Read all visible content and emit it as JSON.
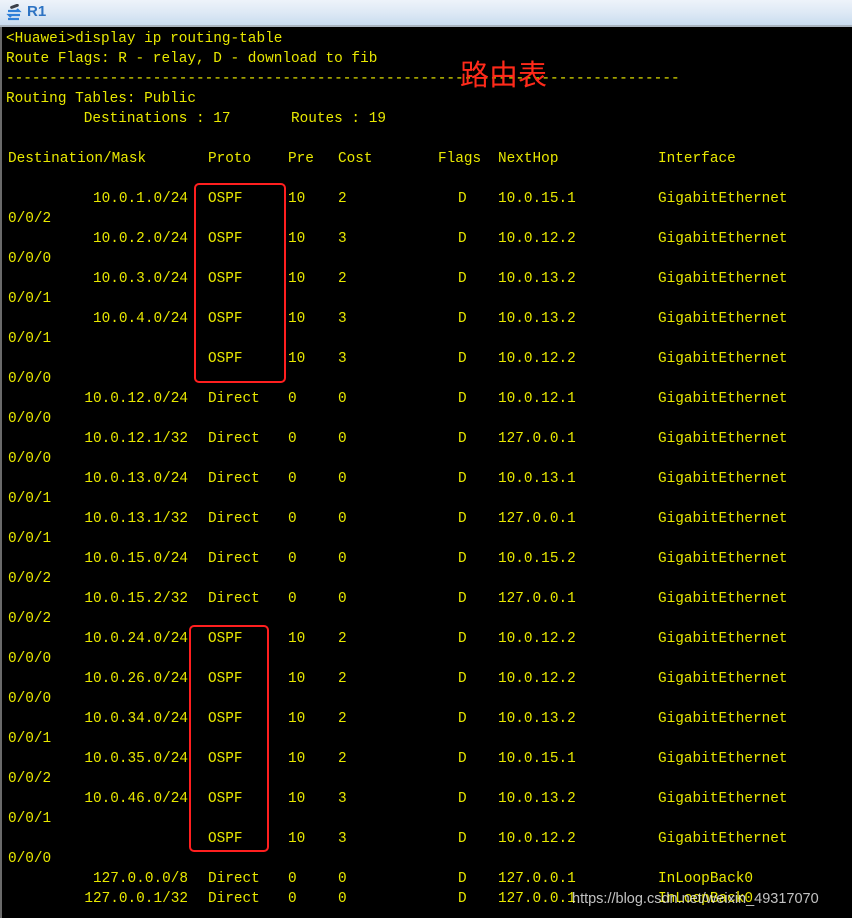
{
  "window": {
    "title": "R1",
    "icon": "router-icon"
  },
  "terminal": {
    "prompt_line": "<Huawei>display ip routing-table",
    "flags_line": "Route Flags: R - relay, D - download to fib",
    "separator": "------------------------------------------------------------------------------",
    "tables_line": "Routing Tables: Public",
    "summary_line": "         Destinations : 17       Routes : 19",
    "columns": [
      "Destination/Mask",
      "Proto",
      "Pre",
      "Cost",
      "Flags",
      "NextHop",
      "Interface"
    ],
    "routes": [
      {
        "dest": "10.0.1.0/24",
        "proto": "OSPF",
        "pre": "10",
        "cost": "2",
        "flags": "D",
        "nexthop": "10.0.15.1",
        "iface": "GigabitEthernet",
        "iface_cont": "0/0/2"
      },
      {
        "dest": "10.0.2.0/24",
        "proto": "OSPF",
        "pre": "10",
        "cost": "3",
        "flags": "D",
        "nexthop": "10.0.12.2",
        "iface": "GigabitEthernet",
        "iface_cont": "0/0/0"
      },
      {
        "dest": "10.0.3.0/24",
        "proto": "OSPF",
        "pre": "10",
        "cost": "2",
        "flags": "D",
        "nexthop": "10.0.13.2",
        "iface": "GigabitEthernet",
        "iface_cont": "0/0/1"
      },
      {
        "dest": "10.0.4.0/24",
        "proto": "OSPF",
        "pre": "10",
        "cost": "3",
        "flags": "D",
        "nexthop": "10.0.13.2",
        "iface": "GigabitEthernet",
        "iface_cont": "0/0/1"
      },
      {
        "dest": "",
        "proto": "OSPF",
        "pre": "10",
        "cost": "3",
        "flags": "D",
        "nexthop": "10.0.12.2",
        "iface": "GigabitEthernet",
        "iface_cont": "0/0/0"
      },
      {
        "dest": "10.0.12.0/24",
        "proto": "Direct",
        "pre": "0",
        "cost": "0",
        "flags": "D",
        "nexthop": "10.0.12.1",
        "iface": "GigabitEthernet",
        "iface_cont": "0/0/0"
      },
      {
        "dest": "10.0.12.1/32",
        "proto": "Direct",
        "pre": "0",
        "cost": "0",
        "flags": "D",
        "nexthop": "127.0.0.1",
        "iface": "GigabitEthernet",
        "iface_cont": "0/0/0"
      },
      {
        "dest": "10.0.13.0/24",
        "proto": "Direct",
        "pre": "0",
        "cost": "0",
        "flags": "D",
        "nexthop": "10.0.13.1",
        "iface": "GigabitEthernet",
        "iface_cont": "0/0/1"
      },
      {
        "dest": "10.0.13.1/32",
        "proto": "Direct",
        "pre": "0",
        "cost": "0",
        "flags": "D",
        "nexthop": "127.0.0.1",
        "iface": "GigabitEthernet",
        "iface_cont": "0/0/1"
      },
      {
        "dest": "10.0.15.0/24",
        "proto": "Direct",
        "pre": "0",
        "cost": "0",
        "flags": "D",
        "nexthop": "10.0.15.2",
        "iface": "GigabitEthernet",
        "iface_cont": "0/0/2"
      },
      {
        "dest": "10.0.15.2/32",
        "proto": "Direct",
        "pre": "0",
        "cost": "0",
        "flags": "D",
        "nexthop": "127.0.0.1",
        "iface": "GigabitEthernet",
        "iface_cont": "0/0/2"
      },
      {
        "dest": "10.0.24.0/24",
        "proto": "OSPF",
        "pre": "10",
        "cost": "2",
        "flags": "D",
        "nexthop": "10.0.12.2",
        "iface": "GigabitEthernet",
        "iface_cont": "0/0/0"
      },
      {
        "dest": "10.0.26.0/24",
        "proto": "OSPF",
        "pre": "10",
        "cost": "2",
        "flags": "D",
        "nexthop": "10.0.12.2",
        "iface": "GigabitEthernet",
        "iface_cont": "0/0/0"
      },
      {
        "dest": "10.0.34.0/24",
        "proto": "OSPF",
        "pre": "10",
        "cost": "2",
        "flags": "D",
        "nexthop": "10.0.13.2",
        "iface": "GigabitEthernet",
        "iface_cont": "0/0/1"
      },
      {
        "dest": "10.0.35.0/24",
        "proto": "OSPF",
        "pre": "10",
        "cost": "2",
        "flags": "D",
        "nexthop": "10.0.15.1",
        "iface": "GigabitEthernet",
        "iface_cont": "0/0/2"
      },
      {
        "dest": "10.0.46.0/24",
        "proto": "OSPF",
        "pre": "10",
        "cost": "3",
        "flags": "D",
        "nexthop": "10.0.13.2",
        "iface": "GigabitEthernet",
        "iface_cont": "0/0/1"
      },
      {
        "dest": "",
        "proto": "OSPF",
        "pre": "10",
        "cost": "3",
        "flags": "D",
        "nexthop": "10.0.12.2",
        "iface": "GigabitEthernet",
        "iface_cont": "0/0/0"
      },
      {
        "dest": "127.0.0.0/8",
        "proto": "Direct",
        "pre": "0",
        "cost": "0",
        "flags": "D",
        "nexthop": "127.0.0.1",
        "iface": "InLoopBack0",
        "iface_cont": ""
      },
      {
        "dest": "127.0.0.1/32",
        "proto": "Direct",
        "pre": "0",
        "cost": "0",
        "flags": "D",
        "nexthop": "127.0.0.1",
        "iface": "InLoopBack0",
        "iface_cont": ""
      }
    ]
  },
  "annotation": {
    "label": "路由表",
    "color": "#ff2a1a"
  },
  "watermark": "https://blog.csdn.net/weixin_49317070",
  "colors": {
    "terminal_text": "#e8e800",
    "terminal_bg": "#000000",
    "highlight_box": "#ff1f1f"
  }
}
